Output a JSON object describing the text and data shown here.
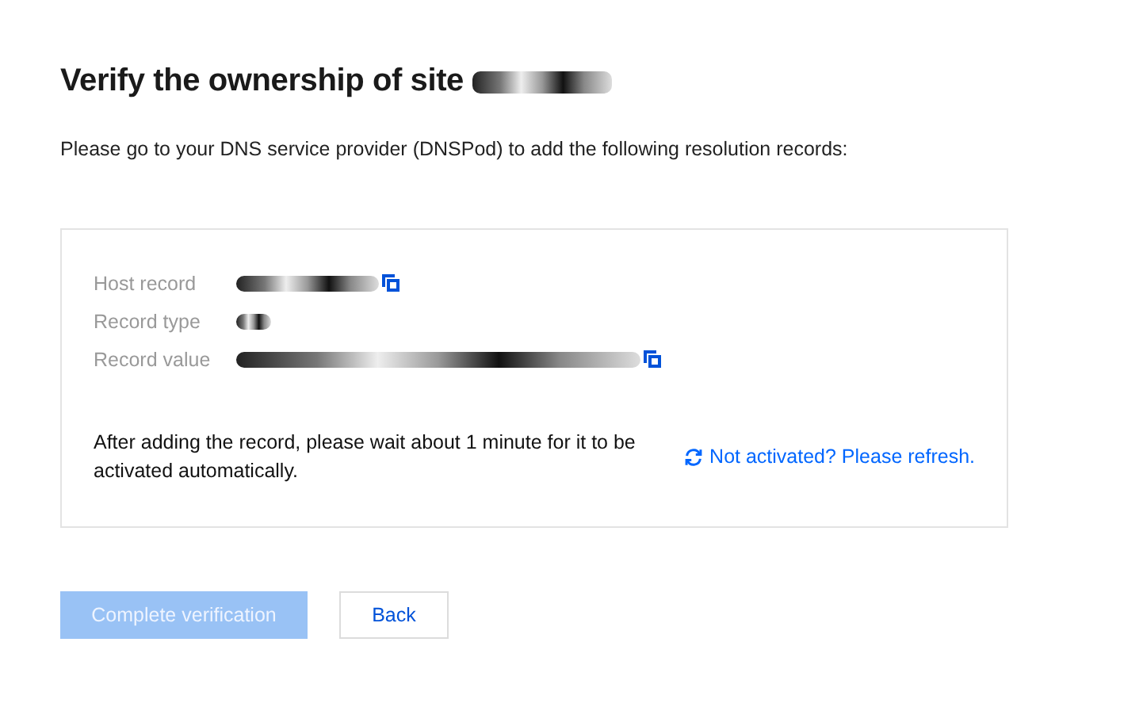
{
  "title": "Verify the ownership of site",
  "instruction": "Please go to your DNS service provider (DNSPod) to add the following resolution records:",
  "records": [
    {
      "label": "Host record",
      "copyable": true
    },
    {
      "label": "Record type",
      "copyable": false
    },
    {
      "label": "Record value",
      "copyable": true
    }
  ],
  "note": "After adding the record, please wait about 1 minute for it to be activated automatically.",
  "refresh_link": "Not activated? Please refresh.",
  "buttons": [
    {
      "label": "Complete verification",
      "kind": "primary",
      "disabled": true
    },
    {
      "label": "Back",
      "kind": "secondary",
      "disabled": false
    }
  ]
}
